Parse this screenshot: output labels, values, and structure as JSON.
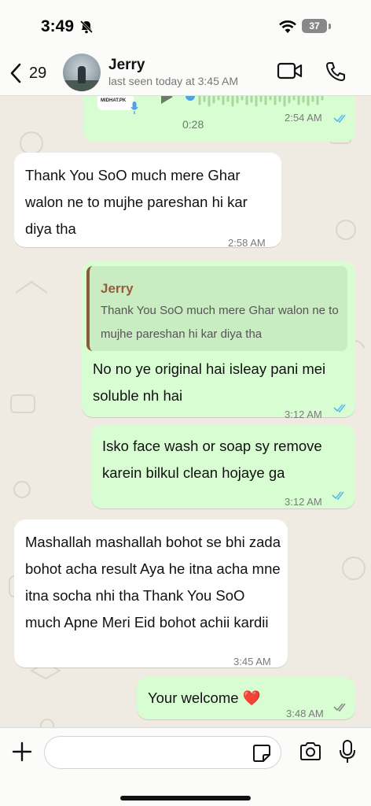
{
  "status_bar": {
    "time": "3:49",
    "battery": "37"
  },
  "header": {
    "back_count": "29",
    "contact_name": "Jerry",
    "last_seen": "last seen today at 3:45 AM"
  },
  "voice_note": {
    "duration": "0:28",
    "time": "2:54 AM",
    "thumb_text": "MIDHAT.PK"
  },
  "messages": [
    {
      "direction": "in",
      "text": "Thank You SoO much mere Ghar walon ne to mujhe pareshan hi kar diya tha",
      "time": "2:58 AM"
    },
    {
      "direction": "out",
      "reply_name": "Jerry",
      "reply_text": "Thank You SoO much mere Ghar walon ne to mujhe pareshan hi kar diya tha",
      "text": "No no ye original hai isleay pani mei soluble nh hai",
      "time": "3:12 AM"
    },
    {
      "direction": "out",
      "text": "Isko face wash or soap sy remove karein bilkul clean hojaye ga",
      "time": "3:12 AM"
    },
    {
      "direction": "in",
      "text": "Mashallah mashallah bohot se bhi zada bohot acha result Aya he itna acha mne itna socha nhi tha Thank You SoO much Apne Meri Eid bohot achii kardii",
      "time": "3:45 AM"
    },
    {
      "direction": "out",
      "text": "Your welcome ❤️",
      "time": "3:48 AM"
    }
  ],
  "composer": {
    "value": "",
    "placeholder": ""
  },
  "colors": {
    "outgoing": "#d9fdd3",
    "incoming": "#ffffff",
    "wallpaper": "#efeae2",
    "read_ticks": "#53bdeb"
  }
}
